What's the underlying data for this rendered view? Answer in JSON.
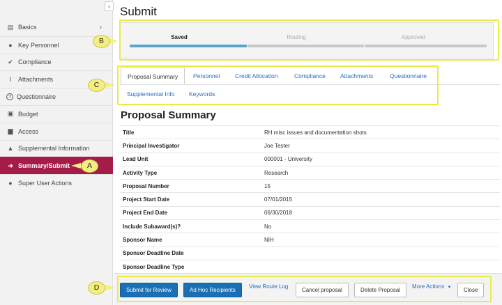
{
  "sidebar": {
    "collapse_glyph": "‹",
    "items": [
      {
        "label": "Basics",
        "icon": "document-icon",
        "glyph": "▤",
        "has_chevron": true
      },
      {
        "label": "Key Personnel",
        "icon": "person-icon",
        "glyph": "●"
      },
      {
        "label": "Compliance",
        "icon": "checkmark-icon",
        "glyph": "✔"
      },
      {
        "label": "Attachments",
        "icon": "paperclip-icon",
        "glyph": "⌇"
      },
      {
        "label": "Questionnaire",
        "icon": "question-icon",
        "glyph": "?"
      },
      {
        "label": "Budget",
        "icon": "money-icon",
        "glyph": "▣"
      },
      {
        "label": "Access",
        "icon": "lock-icon",
        "glyph": "▆"
      },
      {
        "label": "Supplemental Information",
        "icon": "bell-icon",
        "glyph": "▲"
      },
      {
        "label": "Summary/Submit",
        "icon": "submit-icon",
        "glyph": "➜",
        "active": true
      },
      {
        "label": "Super User Actions",
        "icon": "super-user-icon",
        "glyph": "●"
      }
    ],
    "chevron": "›"
  },
  "page": {
    "title": "Submit"
  },
  "status": {
    "steps": [
      {
        "label": "Saved",
        "done": true
      },
      {
        "label": "Routing",
        "done": false
      },
      {
        "label": "Approved",
        "done": false
      }
    ]
  },
  "tabs": [
    {
      "label": "Proposal Summary",
      "active": true
    },
    {
      "label": "Personnel"
    },
    {
      "label": "Credit Allocation"
    },
    {
      "label": "Compliance"
    },
    {
      "label": "Attachments"
    },
    {
      "label": "Questionnaire"
    },
    {
      "label": "Supplemental Info"
    },
    {
      "label": "Keywords"
    }
  ],
  "summary": {
    "title": "Proposal Summary",
    "rows": [
      {
        "label": "Title",
        "value": "RH misc issues and documentation shots"
      },
      {
        "label": "Principal Investigator",
        "value": "Joe Tester"
      },
      {
        "label": "Lead Unit",
        "value": "000001 - University"
      },
      {
        "label": "Activity Type",
        "value": "Research"
      },
      {
        "label": "Proposal Number",
        "value": "15"
      },
      {
        "label": "Project Start Date",
        "value": "07/01/2015"
      },
      {
        "label": "Project End Date",
        "value": "06/30/2018"
      },
      {
        "label": "Include Subaward(s)?",
        "value": "No"
      },
      {
        "label": "Sponsor Name",
        "value": "NIH"
      },
      {
        "label": "Sponsor Deadline Date",
        "value": ""
      },
      {
        "label": "Sponsor Deadline Type",
        "value": ""
      }
    ]
  },
  "actions": {
    "submit_for_review": "Submit for Review",
    "ad_hoc_recipients": "Ad Hoc Recipients",
    "view_route_log": "View Route Log",
    "cancel_proposal": "Cancel proposal",
    "delete_proposal": "Delete Proposal",
    "more_actions": "More Actions",
    "more_actions_caret": "▼",
    "close": "Close"
  },
  "callouts": {
    "a": "A",
    "b": "B",
    "c": "C",
    "d": "D"
  },
  "colors": {
    "accent_active_nav": "#a61c49",
    "primary_button": "#1a6fb5",
    "progress_done": "#5aa5c6",
    "callout_yellow": "#eaea4a",
    "link": "#2a6ebb"
  }
}
